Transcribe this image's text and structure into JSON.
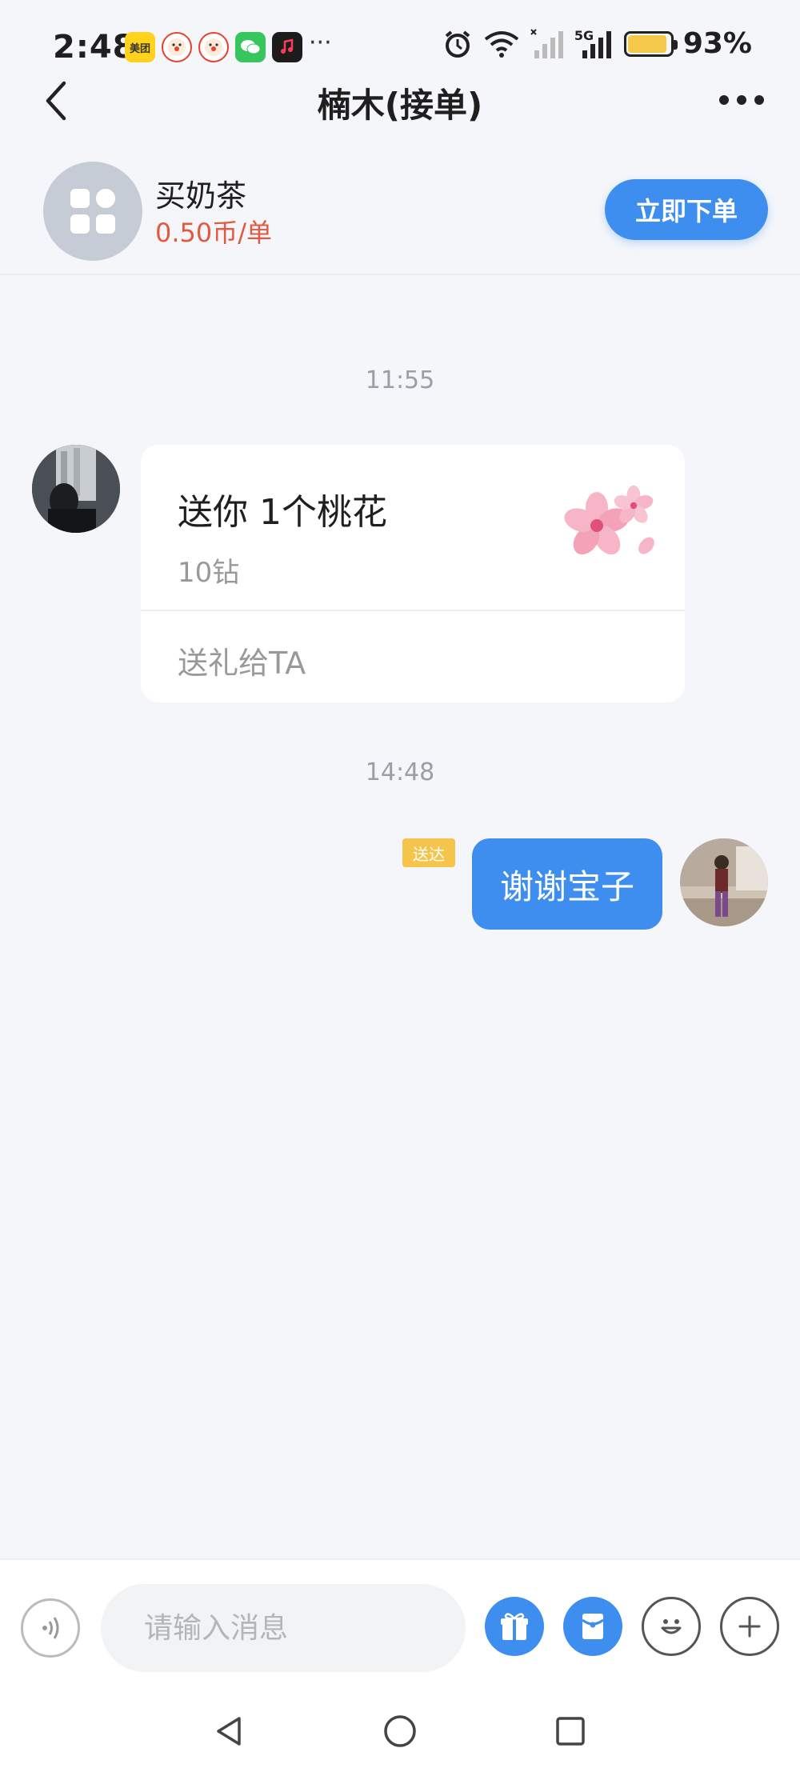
{
  "status_bar": {
    "time": "2:48",
    "app_icons": [
      {
        "name": "meituan-icon",
        "label": "美团"
      },
      {
        "name": "clown-app-icon",
        "label": ""
      },
      {
        "name": "clown-app-icon-2",
        "label": ""
      },
      {
        "name": "wechat-icon",
        "label": ""
      },
      {
        "name": "music-icon",
        "label": ""
      }
    ],
    "overflow": "···",
    "network_label": "5G",
    "battery_percent": "93%",
    "battery_level": 0.93
  },
  "header": {
    "title": "楠木(接单)"
  },
  "service": {
    "name": "买奶茶",
    "price": "0.50币/单",
    "order_button": "立即下单"
  },
  "chat": {
    "messages": [
      {
        "timestamp": "11:55",
        "gift": {
          "title": "送你 1个桃花",
          "price": "10钻",
          "action": "送礼给TA"
        }
      },
      {
        "timestamp": "14:48",
        "status": "送达",
        "text": "谢谢宝子"
      }
    ]
  },
  "input": {
    "placeholder": "请输入消息"
  },
  "colors": {
    "accent": "#3e8ef0",
    "price": "#e4583f",
    "badge": "#f5c44a",
    "background": "#f4f6fa"
  }
}
